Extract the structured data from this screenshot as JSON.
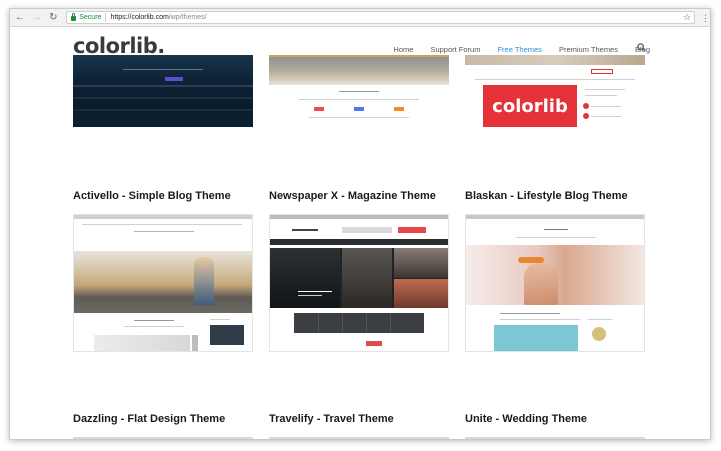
{
  "browser": {
    "secure_label": "Secure",
    "url_host": "https://colorlib.com",
    "url_path": "/wp/themes/"
  },
  "site": {
    "logo": "colorlib",
    "logo_dot": ".",
    "nav": [
      "Home",
      "Support Forum",
      "Free Themes",
      "Premium Themes",
      "Blog"
    ],
    "active_nav": "Free Themes"
  },
  "themes_row1": [
    {
      "title": "Activello - Simple Blog Theme"
    },
    {
      "title": "Newspaper X - Magazine Theme"
    },
    {
      "title": "Blaskan - Lifestyle Blog Theme"
    }
  ],
  "themes_row2": [
    {
      "title": "Dazzling - Flat Design Theme"
    },
    {
      "title": "Travelify - Travel Theme"
    },
    {
      "title": "Unite - Wedding Theme"
    }
  ],
  "thumb_text": {
    "blaskan_block": "colorlib"
  },
  "colors": {
    "accent": "#2b8fd7",
    "colorlib_red": "#e53238"
  }
}
